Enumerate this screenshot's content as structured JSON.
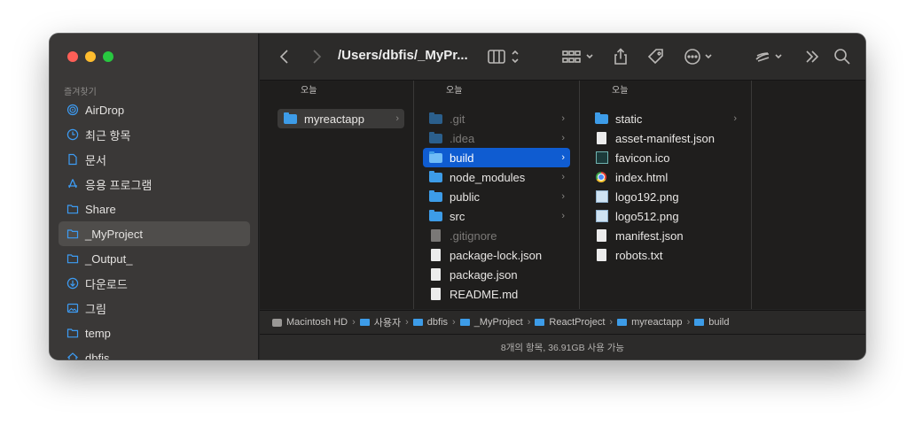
{
  "window": {
    "title_path": "/Users/dbfis/_MyPr...",
    "traffic_lights": {
      "close": "#fe5f57",
      "minimize": "#febc2e",
      "zoom": "#28c840"
    }
  },
  "sidebar": {
    "section_label": "즐겨찾기",
    "items": [
      {
        "label": "AirDrop",
        "icon": "airdrop-icon"
      },
      {
        "label": "최근 항목",
        "icon": "clock-icon"
      },
      {
        "label": "문서",
        "icon": "document-icon"
      },
      {
        "label": "응용 프로그램",
        "icon": "applications-icon"
      },
      {
        "label": "Share",
        "icon": "folder-icon"
      },
      {
        "label": "_MyProject",
        "icon": "folder-icon",
        "selected": true
      },
      {
        "label": "_Output_",
        "icon": "folder-icon"
      },
      {
        "label": "다운로드",
        "icon": "download-icon"
      },
      {
        "label": "그림",
        "icon": "pictures-icon"
      },
      {
        "label": "temp",
        "icon": "folder-icon"
      },
      {
        "label": "dbfis",
        "icon": "home-icon"
      }
    ]
  },
  "toolbar": {
    "back": "chevron-left-icon",
    "forward": "chevron-right-icon",
    "view": "column-view-icon",
    "group": "grid-icon",
    "share": "share-icon",
    "tag": "tag-icon",
    "more": "ellipsis-icon",
    "actions": "hook-icon",
    "expand": "double-chevron-icon",
    "search": "search-icon"
  },
  "columns": [
    {
      "header": "오늘",
      "rows": [
        {
          "label": "myreactapp",
          "kind": "folder",
          "chevron": "›",
          "state": "selected-gray"
        }
      ]
    },
    {
      "header": "오늘",
      "rows": [
        {
          "label": ".git",
          "kind": "folder-dim",
          "chevron": "›",
          "state": "dim"
        },
        {
          "label": ".idea",
          "kind": "folder-dim",
          "chevron": "›",
          "state": "dim"
        },
        {
          "label": "build",
          "kind": "folder",
          "chevron": "›",
          "state": "selected-blue"
        },
        {
          "label": "node_modules",
          "kind": "folder",
          "chevron": "›",
          "state": ""
        },
        {
          "label": "public",
          "kind": "folder",
          "chevron": "›",
          "state": ""
        },
        {
          "label": "src",
          "kind": "folder",
          "chevron": "›",
          "state": ""
        },
        {
          "label": ".gitignore",
          "kind": "doc-dim",
          "chevron": "",
          "state": "dim"
        },
        {
          "label": "package-lock.json",
          "kind": "doc",
          "chevron": "",
          "state": ""
        },
        {
          "label": "package.json",
          "kind": "doc",
          "chevron": "",
          "state": ""
        },
        {
          "label": "README.md",
          "kind": "doc",
          "chevron": "",
          "state": ""
        }
      ]
    },
    {
      "header": "오늘",
      "rows": [
        {
          "label": "static",
          "kind": "folder",
          "chevron": "›",
          "state": ""
        },
        {
          "label": "asset-manifest.json",
          "kind": "doc",
          "chevron": "",
          "state": ""
        },
        {
          "label": "favicon.ico",
          "kind": "favicon",
          "chevron": "",
          "state": ""
        },
        {
          "label": "index.html",
          "kind": "chrome",
          "chevron": "",
          "state": ""
        },
        {
          "label": "logo192.png",
          "kind": "image",
          "chevron": "",
          "state": ""
        },
        {
          "label": "logo512.png",
          "kind": "image",
          "chevron": "",
          "state": ""
        },
        {
          "label": "manifest.json",
          "kind": "doc",
          "chevron": "",
          "state": ""
        },
        {
          "label": "robots.txt",
          "kind": "doc",
          "chevron": "",
          "state": ""
        }
      ]
    }
  ],
  "pathbar": [
    {
      "label": "Macintosh HD",
      "icon": "disk-icon"
    },
    {
      "label": "사용자",
      "icon": "folder-icon"
    },
    {
      "label": "dbfis",
      "icon": "folder-icon"
    },
    {
      "label": "_MyProject",
      "icon": "folder-icon"
    },
    {
      "label": "ReactProject",
      "icon": "folder-icon"
    },
    {
      "label": "myreactapp",
      "icon": "folder-icon"
    },
    {
      "label": "build",
      "icon": "folder-icon"
    }
  ],
  "pathbar_separator": "›",
  "status": "8개의 항목, 36.91GB 사용 가능"
}
